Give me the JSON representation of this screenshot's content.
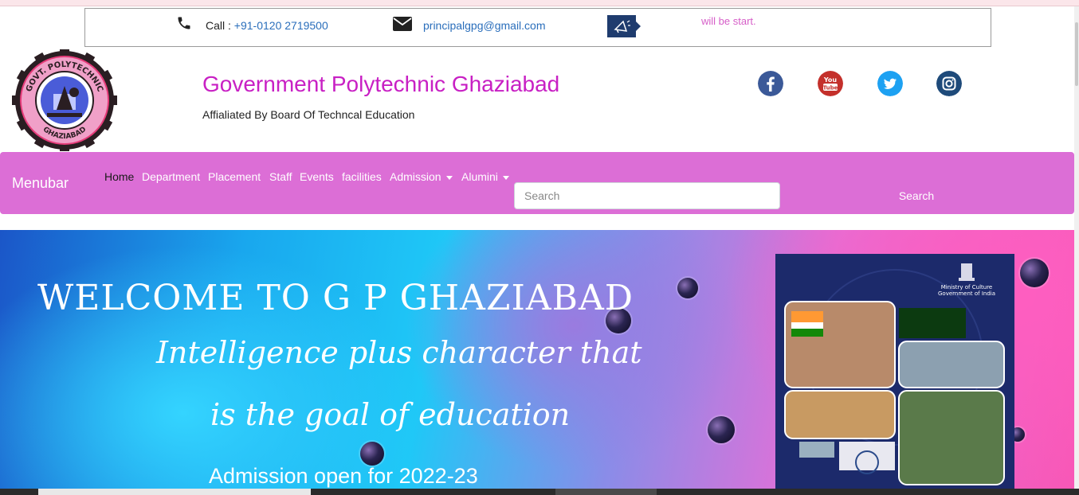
{
  "contact": {
    "call_label": "Call : ",
    "phone": "+91-0120 2719500",
    "email": "principalgpg@gmail.com",
    "marquee": "will be start."
  },
  "header": {
    "title": "Government Polytechnic Ghaziabad",
    "subtitle": "Affialiated By Board Of Techncal Education",
    "logo_text_top": "GOVT. POLYTECHNIC",
    "logo_text_bottom": "GHAZIABAD"
  },
  "social": [
    {
      "name": "facebook-icon",
      "color": "#3b5998"
    },
    {
      "name": "youtube-icon",
      "color": "#c4302b"
    },
    {
      "name": "twitter-icon",
      "color": "#1da1f2"
    },
    {
      "name": "instagram-icon",
      "color": "#1e4a7a"
    }
  ],
  "navbar": {
    "brand": "Menubar",
    "items": [
      {
        "label": "Home"
      },
      {
        "label": "Department"
      },
      {
        "label": "Placement"
      },
      {
        "label": "Staff"
      },
      {
        "label": "Events"
      },
      {
        "label": "facilities"
      },
      {
        "label": "Admission"
      },
      {
        "label": "Alumini"
      }
    ],
    "search_placeholder": "Search",
    "search_button": "Search"
  },
  "hero": {
    "title": "WELCOME TO G P GHAZIABAD",
    "quote_line1": "Intelligence plus character that",
    "quote_line2": "is the goal of education",
    "admission": "Admission open for 2022-23",
    "poster_text_line1": "Ministry of Culture",
    "poster_text_line2": "Government of India"
  },
  "colors": {
    "brand_pink": "#dc6ed6",
    "title_magenta": "#c820c4",
    "link_blue": "#2a6ebb"
  }
}
